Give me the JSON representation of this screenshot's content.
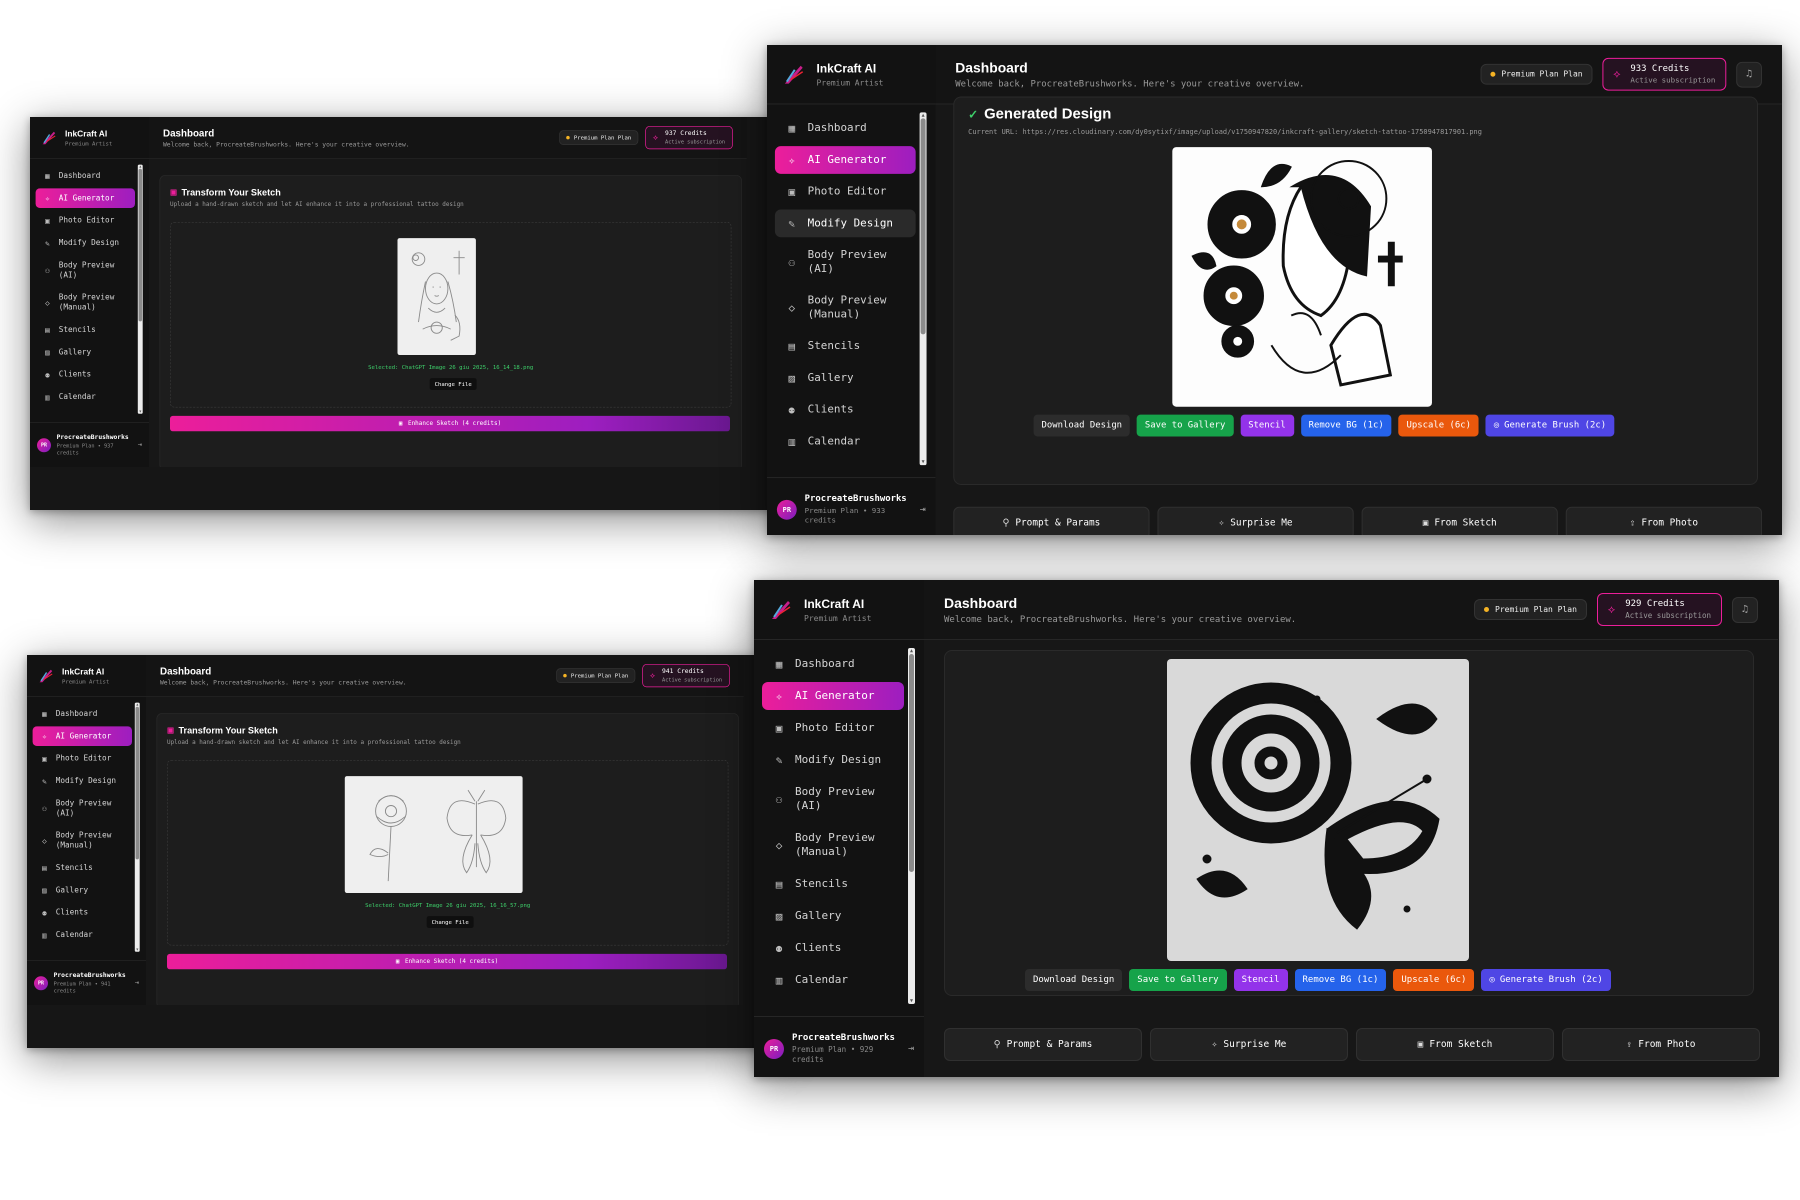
{
  "app": {
    "name": "InkCraft AI",
    "tagline": "Premium Artist"
  },
  "nav": [
    {
      "label": "Dashboard",
      "icon": "dashboard-icon"
    },
    {
      "label": "AI Generator",
      "icon": "sparkle-icon"
    },
    {
      "label": "Photo Editor",
      "icon": "image-icon"
    },
    {
      "label": "Modify Design",
      "icon": "pencil-icon"
    },
    {
      "label": "Body Preview (AI)",
      "icon": "user-icon"
    },
    {
      "label": "Body Preview (Manual)",
      "icon": "shield-icon"
    },
    {
      "label": "Stencils",
      "icon": "file-icon"
    },
    {
      "label": "Gallery",
      "icon": "gallery-icon"
    },
    {
      "label": "Clients",
      "icon": "users-icon"
    },
    {
      "label": "Calendar",
      "icon": "calendar-icon"
    }
  ],
  "header": {
    "title": "Dashboard",
    "subtitle": "Welcome back, ProcreateBrushworks. Here's your creative overview.",
    "plan": "Premium Plan Plan",
    "credits_sub": "Active subscription"
  },
  "user": {
    "initials": "PR",
    "name": "ProcreateBrushworks"
  },
  "screens": [
    {
      "credits_label": "937 Credits",
      "user_sub": "Premium Plan • 937 credits",
      "selected": "Selected: ChatGPT Image 26 giu 2025, 16_14_18.png"
    },
    {
      "credits_label": "933 Credits",
      "user_sub": "Premium Plan • 933 credits"
    },
    {
      "credits_label": "941 Credits",
      "user_sub": "Premium Plan • 941 credits",
      "selected": "Selected: ChatGPT Image 26 giu 2025, 16_16_57.png"
    },
    {
      "credits_label": "929 Credits",
      "user_sub": "Premium Plan • 929 credits"
    }
  ],
  "sketch": {
    "title": "Transform Your Sketch",
    "subtitle": "Upload a hand-drawn sketch and let AI enhance it into a professional tattoo design",
    "change_file": "Change File",
    "enhance": "Enhance Sketch (4 credits)"
  },
  "generated": {
    "title": "Generated Design",
    "url": "Current URL: https://res.cloudinary.com/dy0sytixf/image/upload/v1750947820/inkcraft-gallery/sketch-tattoo-1750947817901.png"
  },
  "actions": {
    "download": "Download Design",
    "save": "Save to Gallery",
    "stencil": "Stencil",
    "remove_bg": "Remove BG (1c)",
    "upscale": "Upscale (6c)",
    "brush": "Generate Brush (2c)"
  },
  "tabs": [
    {
      "label": "Prompt & Params",
      "icon": "wand-icon"
    },
    {
      "label": "Surprise Me",
      "icon": "sparkle-icon"
    },
    {
      "label": "From Sketch",
      "icon": "image-icon"
    },
    {
      "label": "From Photo",
      "icon": "upload-icon"
    }
  ]
}
